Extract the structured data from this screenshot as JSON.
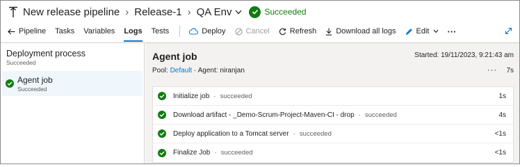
{
  "header": {
    "pipeline_icon": "pipeline-icon",
    "pipeline_name": "New release pipeline",
    "release_name": "Release-1",
    "environment": "QA Env",
    "status": "Succeeded",
    "status_color": "#107c10"
  },
  "toolbar": {
    "back_label": "Pipeline",
    "tabs": [
      "Tasks",
      "Variables",
      "Logs",
      "Tests"
    ],
    "active_tab": "Logs",
    "deploy_label": "Deploy",
    "cancel_label": "Cancel",
    "refresh_label": "Refresh",
    "download_label": "Download all logs",
    "edit_label": "Edit",
    "more_label": "···",
    "accent_color": "#0078d4"
  },
  "left_panel": {
    "deployment_process": {
      "title": "Deployment process",
      "status": "Succeeded"
    },
    "agent_job": {
      "title": "Agent job",
      "status": "Succeeded"
    }
  },
  "job": {
    "title": "Agent job",
    "started_label": "Started: 19/11/2023, 9:21:43 am",
    "pool_label": "Pool:",
    "pool_value": "Default",
    "separator": "·",
    "agent_label": "Agent: niranjan",
    "more": "···",
    "duration": "7s",
    "steps": [
      {
        "name": "Initialize job",
        "status": "succeeded",
        "duration": "1s"
      },
      {
        "name": "Download artifact - _Demo-Scrum-Project-Maven-CI - drop",
        "status": "succeeded",
        "duration": "4s"
      },
      {
        "name": "Deploy application to a Tomcat server",
        "status": "succeeded",
        "duration": "<1s"
      },
      {
        "name": "Finalize Job",
        "status": "succeeded",
        "duration": "<1s"
      }
    ]
  }
}
